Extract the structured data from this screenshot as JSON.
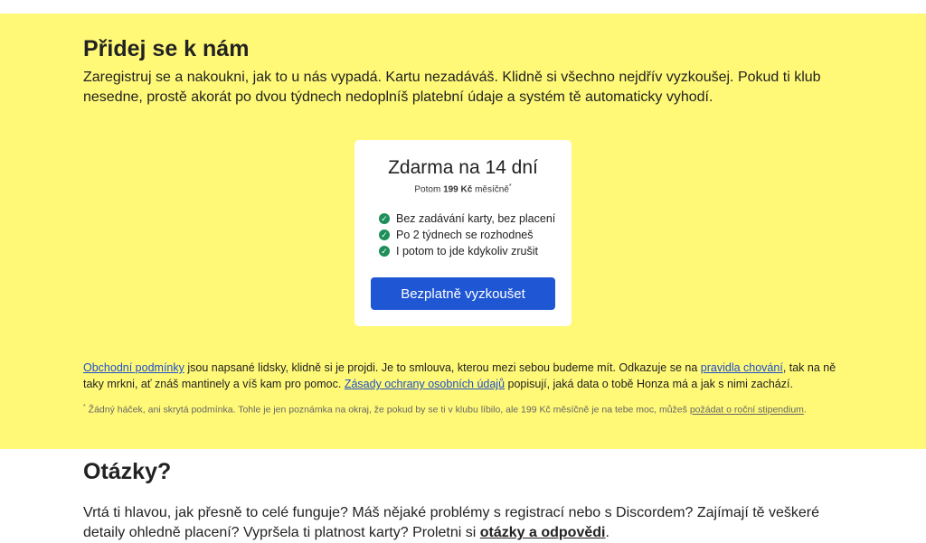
{
  "join": {
    "title": "Přidej se k nám",
    "intro": "Zaregistruj se a nakoukni, jak to u nás vypadá. Kartu nezadáváš. Klidně si všechno nejdřív vyzkoušej. Pokud ti klub nesedne, prostě akorát po dvou týdnech nedoplníš platební údaje a systém tě automaticky vyhodí."
  },
  "card": {
    "title": "Zdarma na 14 dní",
    "price_prefix": "Potom ",
    "price_amount": "199 Kč",
    "price_suffix": " měsíčně",
    "price_mark": "*",
    "features": [
      "Bez zadávání karty, bez placení",
      "Po 2 týdnech se rozhodneš",
      "I potom to jde kdykoliv zrušit"
    ],
    "check_icon": "check-circle-icon",
    "cta_label": "Bezplatně vyzkoušet"
  },
  "legal": {
    "link_terms": "Obchodní podmínky",
    "text1": " jsou napsané lidsky, klidně si je projdi. Je to smlouva, kterou mezi sebou budeme mít. Odkazuje se na ",
    "link_rules": "pravidla chování",
    "text2": ", tak na ně taky mrkni, ať znáš mantinely a víš kam pro pomoc. ",
    "link_privacy": "Zásady ochrany osobních údajů",
    "text3": " popisují, jaká data o tobě Honza má a jak s nimi zachází."
  },
  "footnote": {
    "mark": "*",
    "text": " Žádný háček, ani skrytá podmínka. Tohle je jen poznámka na okraj, že pokud by se ti v klubu líbilo, ale 199 Kč měsíčně je na tebe moc, můžeš ",
    "link": "požádat o roční stipendium",
    "end": "."
  },
  "questions": {
    "title": "Otázky?",
    "text": "Vrtá ti hlavou, jak přesně to celé funguje? Máš nějaké problémy s registrací nebo s Discordem? Zajímají tě veškeré detaily ohledně placení? Vypršela ti platnost karty? Proletni si ",
    "link": "otázky a odpovědi",
    "end": "."
  },
  "colors": {
    "band": "#fff977",
    "button": "#1f56d3",
    "check": "#1e8f5a"
  }
}
